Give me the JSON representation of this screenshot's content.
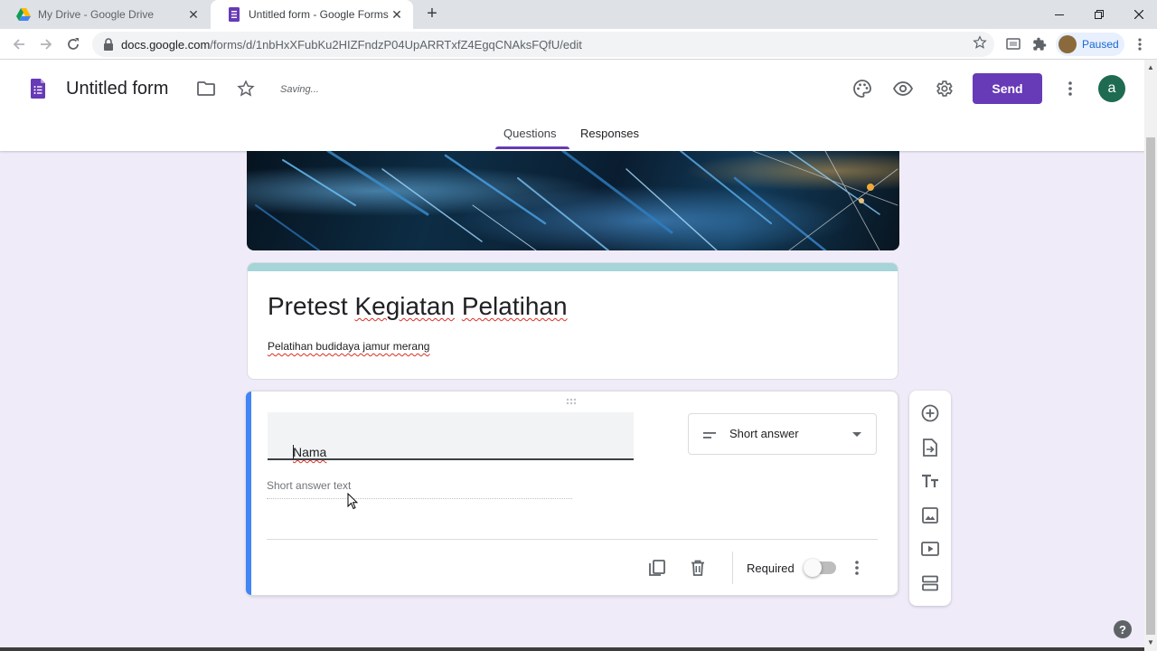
{
  "browser": {
    "tabs": [
      {
        "title": "My Drive - Google Drive",
        "icon": "google-drive-icon"
      },
      {
        "title": "Untitled form - Google Forms",
        "icon": "google-forms-icon"
      }
    ],
    "url_host": "docs.google.com",
    "url_path": "/forms/d/1nbHxXFubKu2HIZFndzP04UpARRTxfZ4EgqCNAksFQfU/edit",
    "profile_status": "Paused"
  },
  "header": {
    "doc_title": "Untitled form",
    "save_status": "Saving...",
    "send_label": "Send",
    "avatar_letter": "a",
    "tabs": [
      {
        "label": "Questions",
        "active": true
      },
      {
        "label": "Responses",
        "active": false
      }
    ]
  },
  "form": {
    "title": "Pretest Kegiatan Pelatihan",
    "description": "Pelatihan budidaya jamur merang"
  },
  "question": {
    "text": "Nama",
    "type": "Short answer",
    "answer_placeholder": "Short answer text",
    "required_label": "Required",
    "required": false
  },
  "colors": {
    "accent": "#673ab7",
    "theme_bar": "#a5d4d9",
    "focus_border": "#4285f4",
    "background": "#f0ebf8"
  }
}
